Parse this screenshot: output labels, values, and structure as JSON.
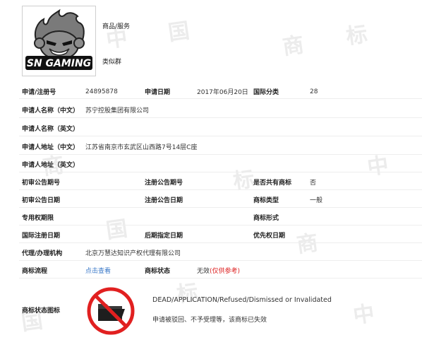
{
  "trademark": {
    "logo_text": "SN GAMING",
    "goods_services_label": "商品/服务",
    "similar_group_label": "类似群"
  },
  "fields": {
    "reg_no_label": "申请/注册号",
    "reg_no_value": "24895878",
    "apply_date_label": "申请日期",
    "apply_date_value": "2017年06月20日",
    "intl_class_label": "国际分类",
    "intl_class_value": "28",
    "applicant_cn_label": "申请人名称（中文）",
    "applicant_cn_value": "苏宁控股集团有限公司",
    "applicant_en_label": "申请人名称（英文）",
    "address_cn_label": "申请人地址（中文）",
    "address_cn_value": "江苏省南京市玄武区山西路7号14层C座",
    "address_en_label": "申请人地址（英文）",
    "prelim_pub_no_label": "初审公告期号",
    "reg_pub_no_label": "注册公告期号",
    "shared_label": "是否共有商标",
    "shared_value": "否",
    "prelim_pub_date_label": "初审公告日期",
    "reg_pub_date_label": "注册公告日期",
    "tm_type_label": "商标类型",
    "tm_type_value": "一般",
    "exclusive_period_label": "专用权期限",
    "tm_form_label": "商标形式",
    "intl_reg_date_label": "国际注册日期",
    "later_date_label": "后期指定日期",
    "priority_date_label": "优先权日期",
    "agent_label": "代理/办理机构",
    "agent_value": "北京万慧达知识产权代理有限公司",
    "process_label": "商标流程",
    "process_link": "点击查看",
    "status_label": "商标状态",
    "status_value": "无效",
    "status_ref": "(仅供参考)",
    "status_icon_label": "商标状态图标"
  },
  "status_detail": {
    "english": "DEAD/APPLICATION/Refused/Dismissed or Invalidated",
    "chinese": "申请被驳回、不予受理等，该商标已失效"
  },
  "watermark": [
    "中",
    "国",
    "商",
    "标"
  ]
}
